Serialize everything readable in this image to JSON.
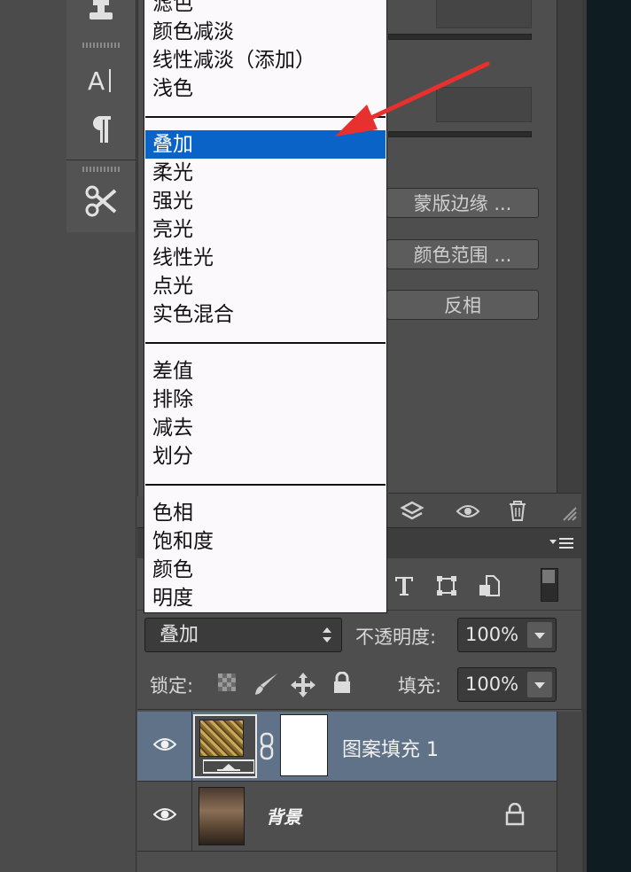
{
  "blend_menu": {
    "groups": [
      [
        "滤色",
        "颜色减淡",
        "线性减淡（添加）",
        "浅色"
      ],
      [
        "叠加",
        "柔光",
        "强光",
        "亮光",
        "线性光",
        "点光",
        "实色混合"
      ],
      [
        "差值",
        "排除",
        "减去",
        "划分"
      ],
      [
        "色相",
        "饱和度",
        "颜色",
        "明度"
      ]
    ],
    "selected": "叠加"
  },
  "properties": {
    "mask_edge_button": "蒙版边缘 ...",
    "color_range_button": "颜色范围 ...",
    "invert_button": "反相"
  },
  "layers_panel": {
    "blend_mode": "叠加",
    "opacity_label": "不透明度:",
    "opacity_value": "100%",
    "lock_label": "锁定:",
    "fill_label": "填充:",
    "fill_value": "100%",
    "layers": [
      {
        "name": "图案填充 1",
        "selected": true
      },
      {
        "name": "背景",
        "locked": true
      }
    ]
  },
  "colors": {
    "selection": "#0a64c8",
    "selected_layer": "#5f7287",
    "annotation_arrow": "#e8302e"
  }
}
